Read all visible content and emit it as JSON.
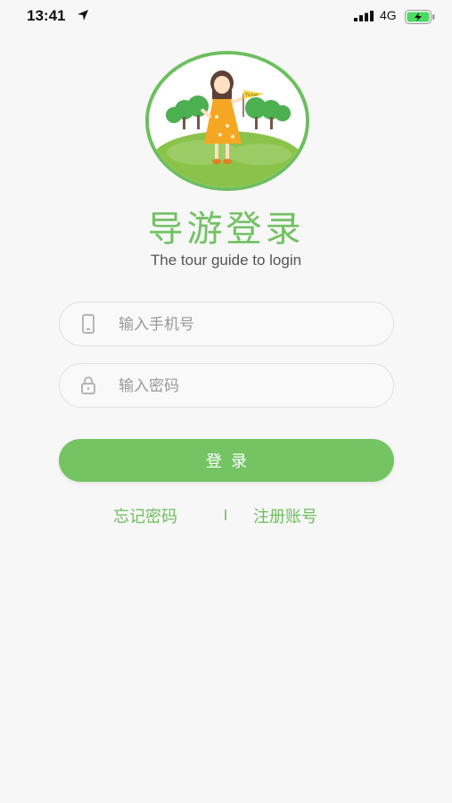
{
  "status_bar": {
    "time": "13:41",
    "network": "4G",
    "icons": [
      "location-arrow-icon",
      "signal-icon",
      "battery-charging-icon"
    ]
  },
  "header": {
    "avatar_icon": "tour-guide-illustration",
    "flag_text": "Ticket",
    "title": "导游登录",
    "subtitle": "The tour guide to login"
  },
  "form": {
    "phone": {
      "placeholder": "输入手机号",
      "value": "",
      "icon": "phone-icon"
    },
    "password": {
      "placeholder": "输入密码",
      "value": "",
      "icon": "lock-icon"
    },
    "login_label": "登录"
  },
  "links": {
    "forgot": "忘记密码",
    "divider": "|",
    "register": "注册账号"
  },
  "colors": {
    "accent": "#75c463",
    "link": "#6dbd5d",
    "background": "#f7f7f7"
  }
}
